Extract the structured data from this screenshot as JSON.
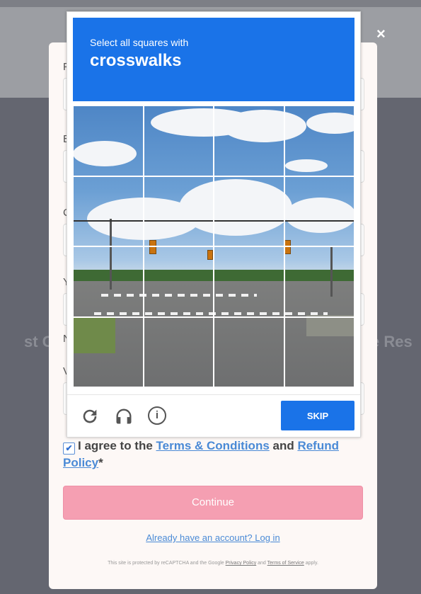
{
  "modal": {
    "close_label": "×"
  },
  "form": {
    "field_fragments": [
      "F",
      "E",
      "C",
      "Y",
      "N",
      "V"
    ],
    "agree_prefix": "I agree to the ",
    "terms_link": "Terms & Conditions",
    "agree_middle": " and ",
    "refund_link": "Refund Policy",
    "agree_suffix": "*",
    "agree_checked": true,
    "continue_label": "Continue",
    "login_link": "Already have an account? Log in",
    "fine_print_prefix": "This site is protected by reCAPTCHA and the Google ",
    "privacy_link": "Privacy Policy",
    "fine_print_and": " and ",
    "tos_link": "Terms of Service",
    "fine_print_suffix": " apply."
  },
  "backdrop": {
    "left_text": "st Ca",
    "right_text": "e Res"
  },
  "captcha": {
    "prompt": "Select all squares with",
    "object": "crosswalks",
    "grid_rows": 4,
    "grid_cols": 4,
    "reload_icon": "reload-icon",
    "audio_icon": "headphones-icon",
    "info_icon": "info-icon",
    "skip_label": "SKIP",
    "accent_color": "#1a73e8"
  }
}
